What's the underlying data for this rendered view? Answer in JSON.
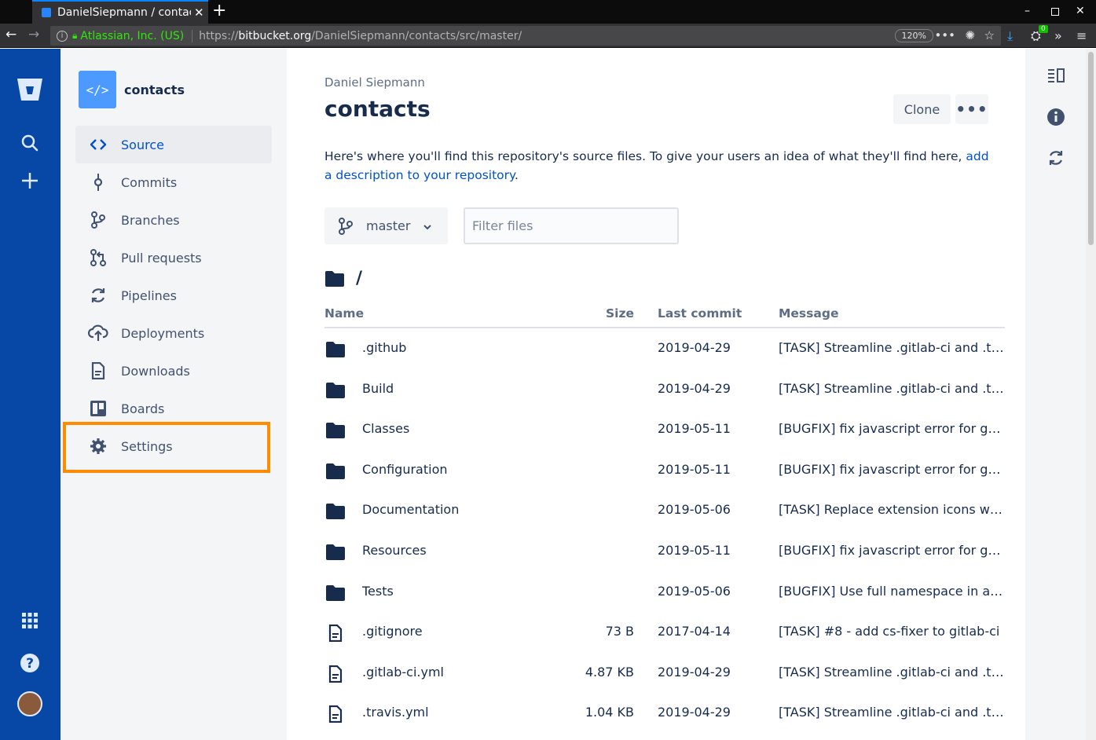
{
  "browser": {
    "tab_title": "DanielSiepmann / contacts",
    "site_identity": "Atlassian, Inc. (US)",
    "url_prefix": "https://",
    "url_host": "bitbucket.org",
    "url_path": "/DanielSiepmann/contacts/src/master/",
    "zoom": "120%",
    "badge_count": "0"
  },
  "sidebar": {
    "repo_name": "contacts",
    "repo_avatar_glyph": "</>",
    "items": [
      {
        "label": "Source",
        "icon": "code-icon",
        "active": true
      },
      {
        "label": "Commits",
        "icon": "commit-icon"
      },
      {
        "label": "Branches",
        "icon": "branch-icon"
      },
      {
        "label": "Pull requests",
        "icon": "pull-request-icon"
      },
      {
        "label": "Pipelines",
        "icon": "pipelines-icon"
      },
      {
        "label": "Deployments",
        "icon": "cloud-upload-icon"
      },
      {
        "label": "Downloads",
        "icon": "document-icon"
      },
      {
        "label": "Boards",
        "icon": "board-icon"
      },
      {
        "label": "Settings",
        "icon": "gear-icon",
        "highlighted": true
      }
    ]
  },
  "main": {
    "owner": "Daniel Siepmann",
    "title": "contacts",
    "clone_label": "Clone",
    "more_label": "•••",
    "description_text": "Here's where you'll find this repository's source files. To give your users an idea of what they'll find here, ",
    "description_link": "add a description to your repository",
    "description_end": ".",
    "branch": "master",
    "filter_placeholder": "Filter files",
    "path": "/",
    "columns": {
      "name": "Name",
      "size": "Size",
      "last_commit": "Last commit",
      "message": "Message"
    },
    "files": [
      {
        "type": "folder",
        "name": ".github",
        "size": "",
        "date": "2019-04-29",
        "message": "[TASK] Streamline .gitlab-ci and .tra…"
      },
      {
        "type": "folder",
        "name": "Build",
        "size": "",
        "date": "2019-04-29",
        "message": "[TASK] Streamline .gitlab-ci and .tra…"
      },
      {
        "type": "folder",
        "name": "Classes",
        "size": "",
        "date": "2019-05-11",
        "message": "[BUGFIX] fix javascript error for gm…"
      },
      {
        "type": "folder",
        "name": "Configuration",
        "size": "",
        "date": "2019-05-11",
        "message": "[BUGFIX] fix javascript error for gm…"
      },
      {
        "type": "folder",
        "name": "Documentation",
        "size": "",
        "date": "2019-05-06",
        "message": "[TASK] Replace extension icons wit…"
      },
      {
        "type": "folder",
        "name": "Resources",
        "size": "",
        "date": "2019-05-11",
        "message": "[BUGFIX] fix javascript error for gm…"
      },
      {
        "type": "folder",
        "name": "Tests",
        "size": "",
        "date": "2019-05-06",
        "message": "[BUGFIX] Use full namespace in an…"
      },
      {
        "type": "file",
        "name": ".gitignore",
        "size": "73 B",
        "date": "2017-04-14",
        "message": "[TASK] #8 - add cs-fixer to gitlab-ci"
      },
      {
        "type": "file",
        "name": ".gitlab-ci.yml",
        "size": "4.87 KB",
        "date": "2019-04-29",
        "message": "[TASK] Streamline .gitlab-ci and .tra…"
      },
      {
        "type": "file",
        "name": ".travis.yml",
        "size": "1.04 KB",
        "date": "2019-04-29",
        "message": "[TASK] Streamline .gitlab-ci and .tra…"
      }
    ]
  },
  "colors": {
    "global_nav": "#0747a6",
    "link": "#0052cc",
    "highlight": "#ff8b00",
    "text": "#172b4d"
  }
}
